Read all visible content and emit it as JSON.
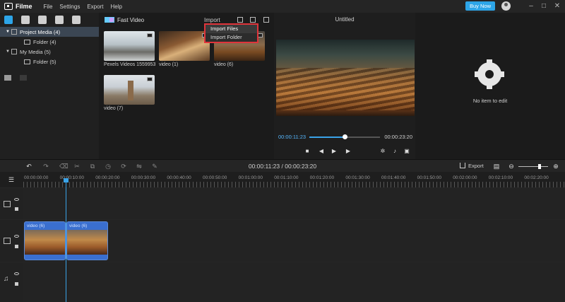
{
  "app": {
    "name": "Filme",
    "menu": [
      "File",
      "Settings",
      "Export",
      "Help"
    ],
    "buy_label": "Buy Now",
    "window_controls": [
      "minimize-icon",
      "maximize-icon",
      "close-icon"
    ]
  },
  "media_panel": {
    "tabs": [
      "media-icon",
      "effects-icon",
      "filters-icon",
      "text-icon",
      "music-icon"
    ],
    "tree": [
      {
        "label": "Project Media (4)",
        "selected": true
      },
      {
        "label": "Folder (4)",
        "child": true
      },
      {
        "label": "My Media (5)"
      },
      {
        "label": "Folder (5)",
        "child": true
      }
    ]
  },
  "media_grid": {
    "fast_video_label": "Fast Video",
    "import_label": "Import",
    "items": [
      {
        "caption": "Pexels Videos 1559953"
      },
      {
        "caption": "video (1)"
      },
      {
        "caption": "video (6)"
      },
      {
        "caption": "video (7)"
      }
    ]
  },
  "import_menu": {
    "items": [
      "Import Files",
      "Import Folder"
    ]
  },
  "preview": {
    "title": "Untitled",
    "current_time": "00:00:11:23",
    "total_time": "00:00:23:20",
    "progress": 0.5
  },
  "properties": {
    "empty_text": "No item to edit"
  },
  "timeline": {
    "timecode": "00:00:11:23 / 00:00:23:20",
    "export_label": "Export",
    "zoom_level": 0.7,
    "ruler": [
      "00:00:00:00",
      "00:00:10:00",
      "00:00:20:00",
      "00:00:30:00",
      "00:00:40:00",
      "00:00:50:00",
      "00:01:00:00",
      "00:01:10:00",
      "00:01:20:00",
      "00:01:30:00",
      "00:01:40:00",
      "00:01:50:00",
      "00:02:00:00",
      "00:02:10:00",
      "00:02:20:00"
    ],
    "clips": [
      "video (6)",
      "video (6)"
    ]
  },
  "colors": {
    "accent": "#2da5e8",
    "clip": "#3a6fcf",
    "highlight_border": "#e0343b"
  }
}
